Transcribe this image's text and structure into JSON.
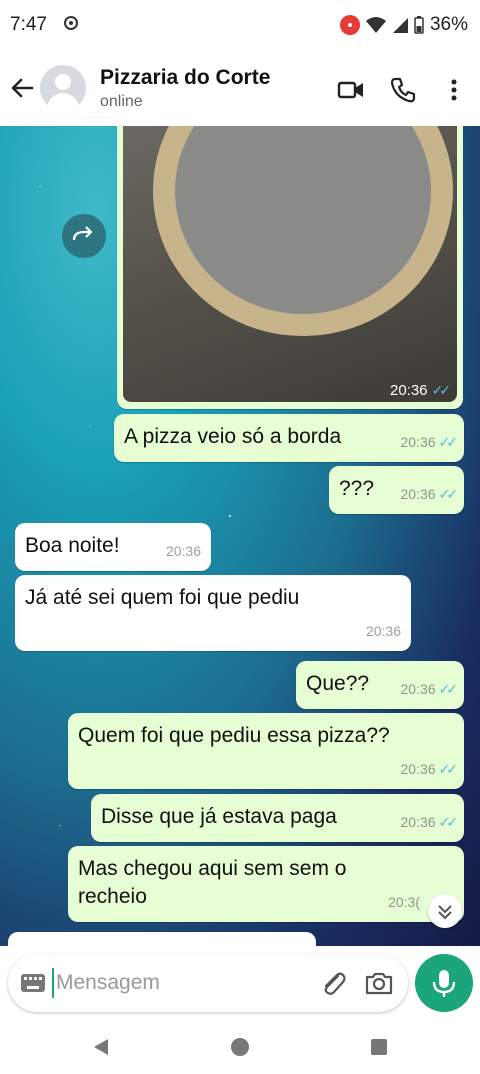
{
  "status": {
    "time": "7:47",
    "battery": "36%"
  },
  "header": {
    "contact_name": "Pizzaria do Corte",
    "status": "online"
  },
  "image_message": {
    "time": "20:36"
  },
  "messages": [
    {
      "dir": "out",
      "text": "A pizza veio só a borda",
      "time": "20:36"
    },
    {
      "dir": "out",
      "text": "???",
      "time": "20:36"
    },
    {
      "dir": "in",
      "text": "Boa noite!",
      "time": "20:36"
    },
    {
      "dir": "in",
      "text": "Já até sei quem foi que pediu",
      "time": "20:36"
    },
    {
      "dir": "out",
      "text": "Que??",
      "time": "20:36"
    },
    {
      "dir": "out",
      "text": "Quem foi que pediu essa pizza??",
      "time": "20:36"
    },
    {
      "dir": "out",
      "text": "Disse que já estava paga",
      "time": "20:36"
    },
    {
      "dir": "out",
      "text": "Mas chegou aqui sem sem o recheio",
      "time": "20:3("
    }
  ],
  "composer": {
    "placeholder": "Mensagem"
  },
  "colors": {
    "accent": "#1aa57a",
    "outgoing_bubble": "#e7fdd3",
    "incoming_bubble": "#ffffff",
    "read_ticks": "#53bdeb"
  }
}
